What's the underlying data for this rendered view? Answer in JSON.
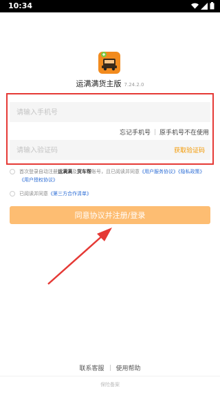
{
  "status_bar": {
    "time": "10:34",
    "icons": [
      "wifi-icon",
      "signal-icon",
      "battery-icon"
    ]
  },
  "app": {
    "icon": "truck-app-icon",
    "name": "运满满货主版",
    "version": "7.24.2.0"
  },
  "form": {
    "phone_placeholder": "请输入手机号",
    "code_placeholder": "请输入验证码",
    "get_code_label": "获取验证码",
    "forgot_phone_label": "忘记手机号",
    "old_phone_unavailable_label": "原手机号不在使用"
  },
  "agreement": {
    "line1_prefix": "首次登录自动注册",
    "brand1": "运满满",
    "and": "及",
    "brand2": "货车帮",
    "line1_mid": "账号，且已阅读并同意",
    "link_service": "《用户服务协议》",
    "link_privacy": "《隐私政策》",
    "link_auth": "《用户授权协议》",
    "line2_prefix": "已阅读并同意",
    "link_third_party": "《第三方合作清单》"
  },
  "submit_label": "同意协议并注册/登录",
  "footer": {
    "customer_service": "联系客服",
    "help": "使用帮助",
    "note": "保险备案"
  },
  "colors": {
    "accent_orange": "#f39800",
    "button_bg": "#fdbd72",
    "link_blue": "#2f6fd6",
    "highlight_red": "#e53935"
  }
}
